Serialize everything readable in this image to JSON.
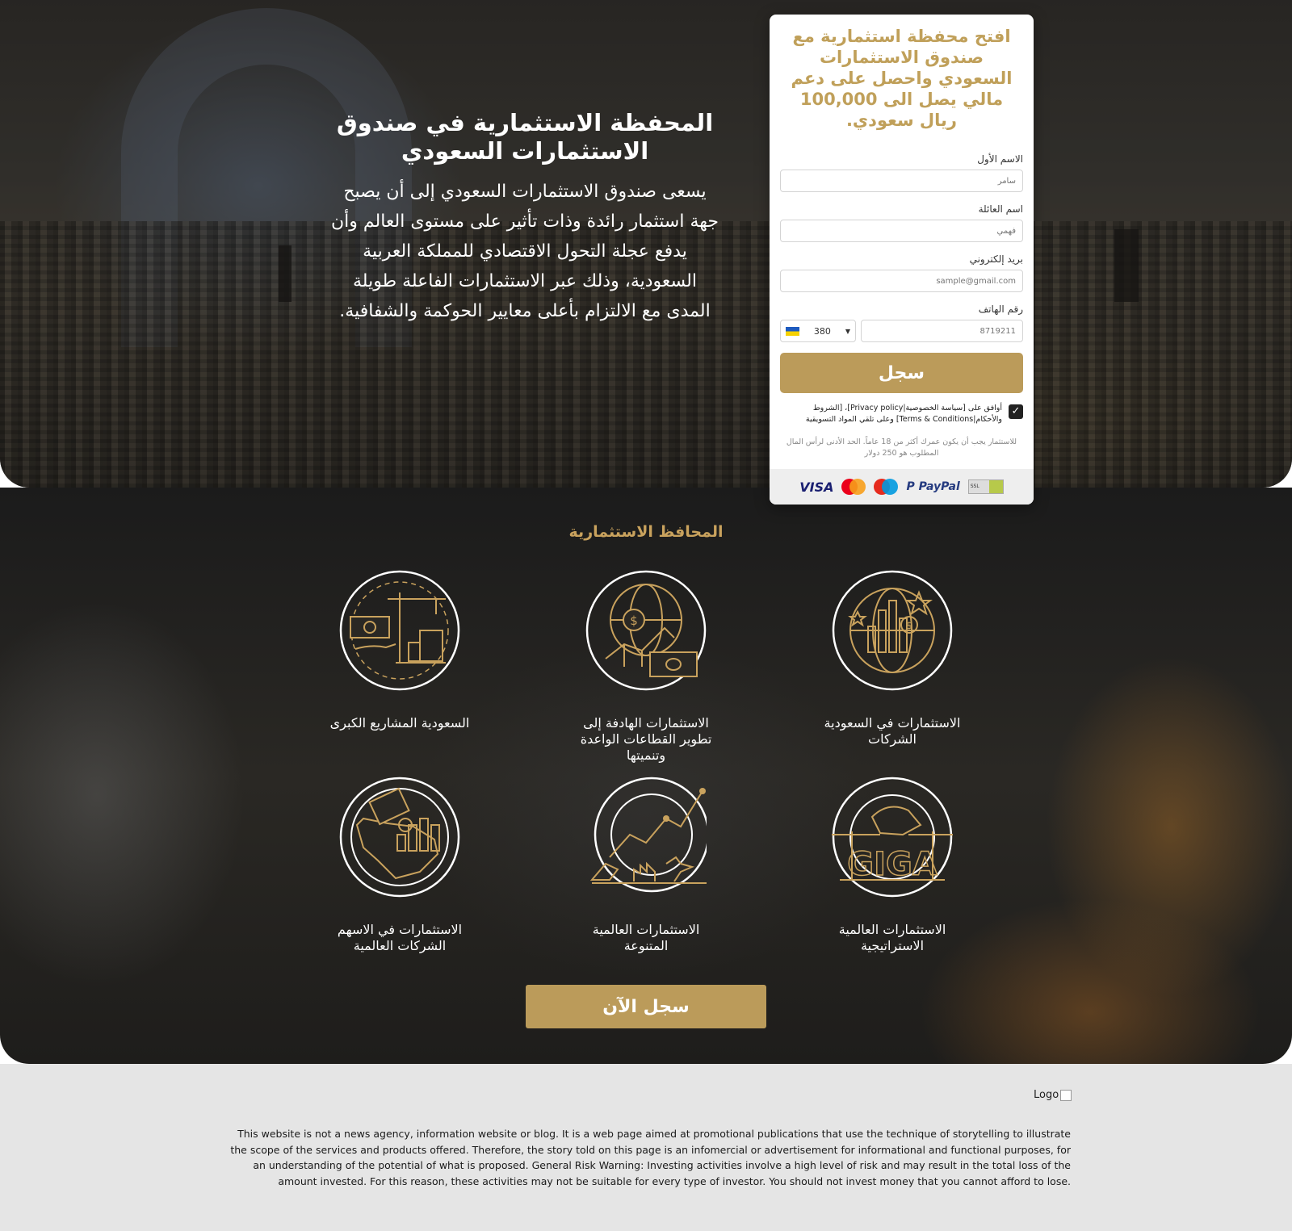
{
  "hero": {
    "title": "المحفظة الاستثمارية في صندوق الاستثمارات السعودي",
    "description": "يسعى صندوق الاستثمارات السعودي إلى أن يصبح جهة استثمار رائدة وذات تأثير على مستوى العالم وأن يدفع عجلة التحول الاقتصادي للمملكة العربية السعودية، وذلك عبر الاستثمارات الفاعلة طويلة المدى مع الالتزام بأعلى معايير الحوكمة والشفافية."
  },
  "form": {
    "headline": "افتح محفظة استثمارية مع صندوق الاستثمارات السعودي واحصل على دعم مالي يصل الى 100,000 ريال سعودي.",
    "first_name": {
      "label": "الاسم الأول",
      "placeholder": "سامر"
    },
    "last_name": {
      "label": "اسم العائلة",
      "placeholder": "فهمي"
    },
    "email": {
      "label": "بريد إلكتروني",
      "placeholder": "sample@gmail.com"
    },
    "phone": {
      "label": "رقم الهاتف",
      "country_code": "380",
      "placeholder": "8719211",
      "flag_icon": "ukraine-flag-icon"
    },
    "submit_label": "سجل",
    "consent_text": "أوافق على [سياسة الخصوصية|Privacy policy]، [الشروط والأحكام|Terms & Conditions] وعلى تلقي المواد التسويقية",
    "consent_checked": true,
    "note": "للاستثمار يجب أن يكون عمرك أكثر من 18 عاماً. الحد الأدنى لرأس المال المطلوب هو 250 دولار",
    "payments": [
      "VISA",
      "mastercard",
      "maestro",
      "PayPal",
      "SSL"
    ]
  },
  "portfolio": {
    "title": "المحافظ الاستثمارية",
    "cards": [
      {
        "label": "الاستثمارات في السعودية الشركات",
        "icon": "globe-chart-stars-icon"
      },
      {
        "label": "الاستثمارات الهادفة إلى تطوير القطاعات الواعدة وتنميتها",
        "icon": "globe-money-growth-icon"
      },
      {
        "label": "السعودية المشاريع الكبرى",
        "icon": "crane-money-building-icon"
      },
      {
        "label": "الاستثمارات العالمية الاستراتيجية",
        "icon": "giga-construction-icon"
      },
      {
        "label": "الاستثمارات العالمية المتنوعة",
        "icon": "global-trade-chart-icon"
      },
      {
        "label": "الاستثمارات في الاسهم الشركات العالمية",
        "icon": "saudi-map-stocks-icon"
      }
    ],
    "cta_label": "سجل الآن"
  },
  "footer": {
    "logo_alt": "Logo",
    "disclaimer": "This website is not a news agency, information website or blog. It is a web page aimed at promotional publications that use the technique of storytelling to illustrate the scope of the services and products offered. Therefore, the story told on this page is an infomercial or advertisement for informational and functional purposes, for an understanding of the potential of what is proposed. General Risk Warning: Investing activities involve a high level of risk and may result in the total loss of the amount invested. For this reason, these activities may not be suitable for every type of investor. You should not invest money that you cannot afford to lose."
  },
  "colors": {
    "gold": "#bb9b5a",
    "gold_text": "#c0a05a",
    "footer_bg": "#e5e5e5"
  }
}
